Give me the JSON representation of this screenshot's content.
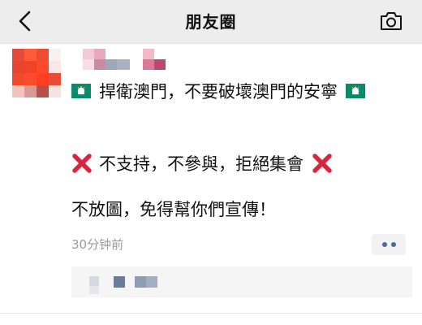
{
  "header": {
    "title": "朋友圈",
    "back_icon": "chevron-left-icon",
    "camera_icon": "camera-icon",
    "background": "#ededed"
  },
  "post": {
    "line1_text": "捍衛澳門，不要破壞澳門的安寧",
    "line2_text": "不支持，不參與，拒絕集會",
    "line3_text": "不放圖，免得幫你們宣傳！",
    "timestamp": "30分钟前",
    "flag_icon": "macau-flag-icon",
    "cross_icon": "cross-mark-icon",
    "more_icon": "more-dots-icon",
    "cross_color": "#d7263d",
    "flag_color": "#0b8a6b",
    "link_color": "#4d6a99"
  }
}
